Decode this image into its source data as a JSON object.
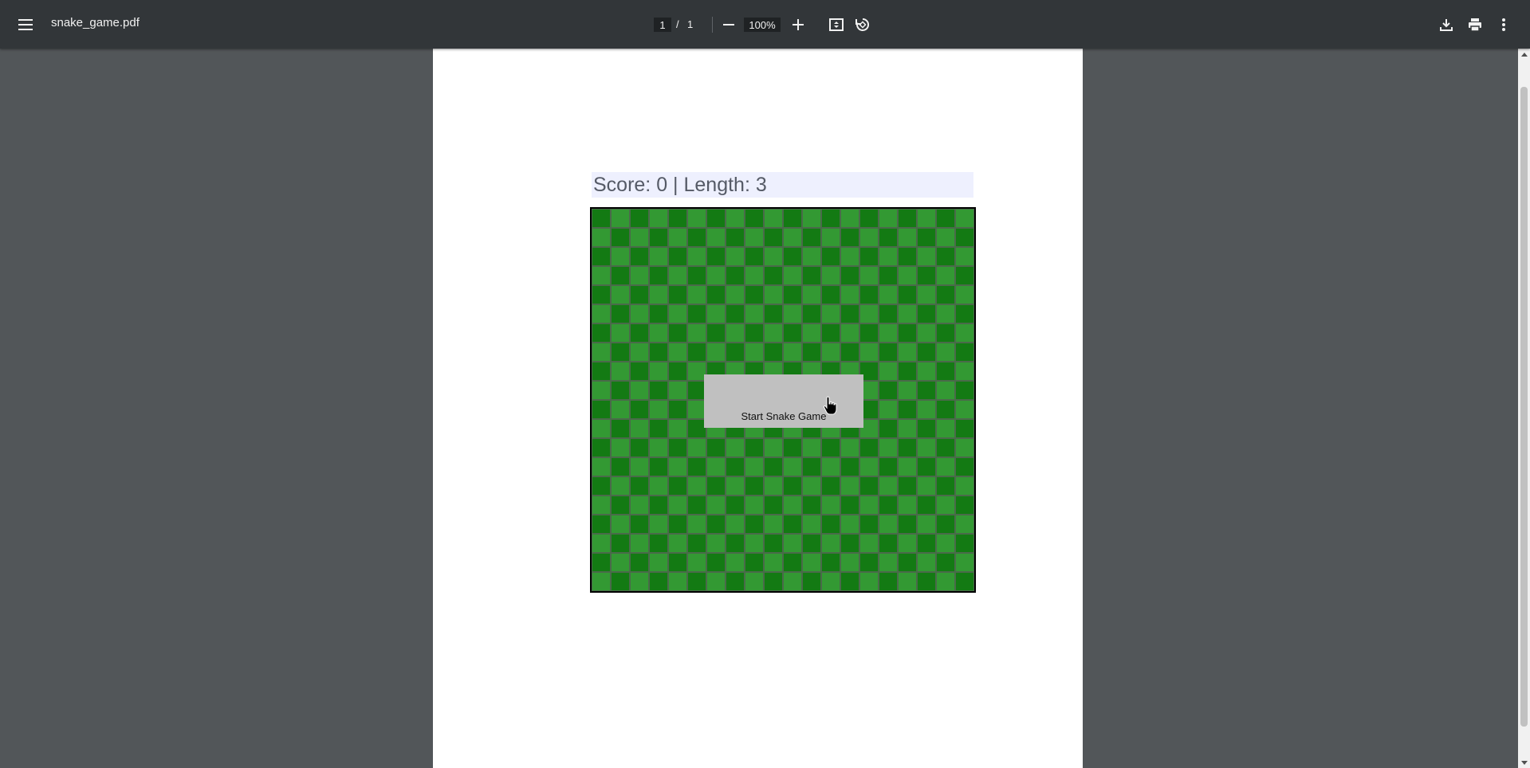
{
  "toolbar": {
    "doc_title": "snake_game.pdf",
    "page_current": "1",
    "page_separator": "/",
    "page_total": "1",
    "zoom": "100%",
    "icons": {
      "menu": "menu-icon",
      "zoom_out": "minus-icon",
      "zoom_in": "plus-icon",
      "fit": "fit-to-page-icon",
      "rotate": "rotate-icon",
      "download": "download-icon",
      "print": "print-icon",
      "more": "more-vert-icon"
    }
  },
  "game": {
    "score_text": "Score: 0 | Length: 3",
    "start_button_label": "Start Snake Game",
    "board_colors": {
      "dark": "#137a13",
      "light": "#339933",
      "grid": "#4a6a4a"
    },
    "board_cells": 20
  },
  "colors": {
    "toolbar": "#323639",
    "viewer_bg": "#525659",
    "page": "#ffffff"
  }
}
